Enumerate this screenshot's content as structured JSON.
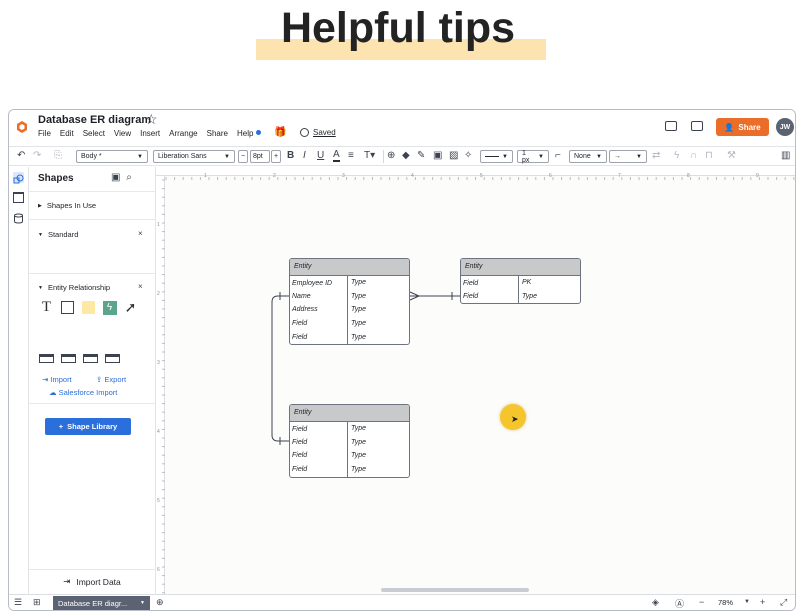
{
  "banner": {
    "title": "Helpful tips"
  },
  "app": {
    "document_title": "Database ER diagram",
    "menu": [
      "File",
      "Edit",
      "Select",
      "View",
      "Insert",
      "Arrange",
      "Share",
      "Help"
    ],
    "saved_label": "Saved",
    "share_label": "Share",
    "avatar_initials": "JW",
    "accent_color": "#ea6e2a",
    "primary_color": "#2a6fdb"
  },
  "toolbar": {
    "style_select": "Body *",
    "font_select": "Liberation Sans",
    "font_size": "8pt",
    "line_width": "1 px",
    "endpoint_select": "None"
  },
  "panel": {
    "title": "Shapes",
    "shapes_in_use": "Shapes In Use",
    "standard": "Standard",
    "entity_relationship": "Entity Relationship",
    "import_label": "Import",
    "export_label": "Export",
    "salesforce_import": "Salesforce Import",
    "shape_library": "Shape Library",
    "import_data": "Import Data"
  },
  "diagram": {
    "employee": {
      "header": "Entity",
      "rows": [
        [
          "Employee ID",
          "Type"
        ],
        [
          "Name",
          "Type"
        ],
        [
          "Address",
          "Type"
        ],
        [
          "Field",
          "Type"
        ],
        [
          "Field",
          "Type"
        ]
      ]
    },
    "right": {
      "header": "Entity",
      "rows": [
        [
          "Field",
          "PK"
        ],
        [
          "Field",
          "Type"
        ]
      ]
    },
    "bottom": {
      "header": "Entity",
      "rows": [
        [
          "Field",
          "Type"
        ],
        [
          "Field",
          "Type"
        ],
        [
          "Field",
          "Type"
        ],
        [
          "Field",
          "Type"
        ]
      ]
    }
  },
  "ruler": {
    "top_ticks": [
      "1",
      "2",
      "3",
      "4",
      "5",
      "6",
      "7",
      "8",
      "9"
    ],
    "left_ticks": [
      "1",
      "2",
      "3",
      "4",
      "5",
      "6"
    ]
  },
  "bottombar": {
    "page_tab": "Database ER diagr...",
    "zoom": "78%"
  }
}
